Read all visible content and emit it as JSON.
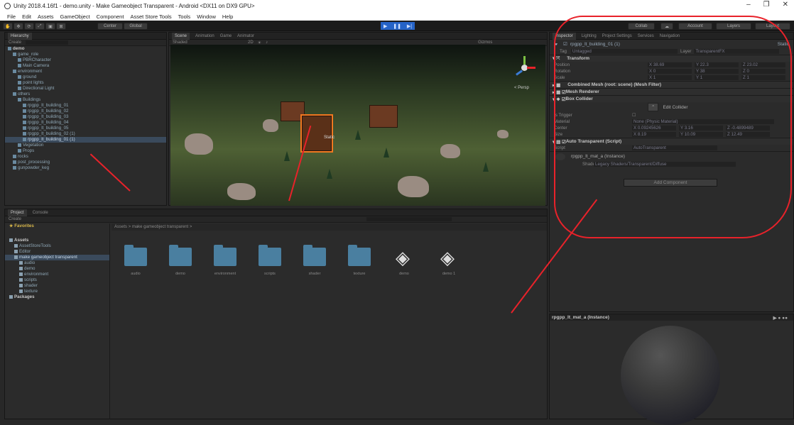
{
  "window": {
    "title": "Unity 2018.4.16f1 - demo.unity - Make Gameobject Transparent - Android <DX11 on DX9 GPU>"
  },
  "menu": [
    "File",
    "Edit",
    "Assets",
    "GameObject",
    "Component",
    "Asset Store Tools",
    "Tools",
    "Window",
    "Help"
  ],
  "toolbar": {
    "center": "Center",
    "global": "Global",
    "collab": "Collab",
    "account": "Account",
    "layers": "Layers",
    "layout": "Layout"
  },
  "hierarchy": {
    "tab": "Hierarchy",
    "create": "Create",
    "items": [
      {
        "label": "demo",
        "indent": 0,
        "hdr": true
      },
      {
        "label": "game_role",
        "indent": 1
      },
      {
        "label": "PBRCharacter",
        "indent": 2
      },
      {
        "label": "Main Camera",
        "indent": 2
      },
      {
        "label": "environment",
        "indent": 1
      },
      {
        "label": "ground",
        "indent": 2
      },
      {
        "label": "point lights",
        "indent": 2
      },
      {
        "label": "Directional Light",
        "indent": 2
      },
      {
        "label": "others",
        "indent": 1
      },
      {
        "label": "Buildings",
        "indent": 2
      },
      {
        "label": "rpgpp_lt_building_01",
        "indent": 3
      },
      {
        "label": "rpgpp_lt_building_02",
        "indent": 3
      },
      {
        "label": "rpgpp_lt_building_03",
        "indent": 3
      },
      {
        "label": "rpgpp_lt_building_04",
        "indent": 3
      },
      {
        "label": "rpgpp_lt_building_05",
        "indent": 3
      },
      {
        "label": "rpgpp_lt_building_02 (1)",
        "indent": 3
      },
      {
        "label": "rpgpp_lt_building_01 (1)",
        "indent": 3,
        "sel": true
      },
      {
        "label": "Vegetation",
        "indent": 2
      },
      {
        "label": "Props",
        "indent": 2
      },
      {
        "label": "rocks",
        "indent": 1
      },
      {
        "label": "post_processing",
        "indent": 1
      },
      {
        "label": "gunpowder_keg",
        "indent": 1
      }
    ]
  },
  "scene": {
    "tabs": [
      "Scene",
      "Animation",
      "Game",
      "Animator"
    ],
    "shaded": "Shaded",
    "mode2d": "2D",
    "gizmos": "Gizmos",
    "persp": "< Persp",
    "static_label": "Static"
  },
  "inspector": {
    "tabs": [
      "Inspector",
      "Lighting",
      "Project Settings",
      "Services",
      "Navigation"
    ],
    "object_name": "rpgpp_lt_building_01 (1)",
    "static": "Static",
    "tag_label": "Tag",
    "tag": "Untagged",
    "layer_label": "Layer",
    "layer": "TransparentFX",
    "transform": {
      "title": "Transform",
      "rows": [
        {
          "label": "Position",
          "x": "X 38.69",
          "y": "Y 22.3",
          "z": "Z 23.02"
        },
        {
          "label": "Rotation",
          "x": "X 0",
          "y": "Y 38",
          "z": "Z 0"
        },
        {
          "label": "Scale",
          "x": "X 1",
          "y": "Y 1",
          "z": "Z 1"
        }
      ]
    },
    "mesh_filter": "Combined Mesh (root: scene) (Mesh Filter)",
    "mesh_renderer": "Mesh Renderer",
    "box_collider": {
      "title": "Box Collider",
      "edit": "Edit Collider",
      "is_trigger": "Is Trigger",
      "material_label": "Material",
      "material": "None (Physic Material)",
      "center_label": "Center",
      "center": [
        "X 0.09245626",
        "Y 3.16",
        "Z -0.4899489"
      ],
      "size_label": "Size",
      "size": [
        "X 8.19",
        "Y 10.09",
        "Z 12.49"
      ]
    },
    "auto_transparent": {
      "title": "Auto Transparent (Script)",
      "script_label": "Script",
      "script": "AutoTransparent"
    },
    "material": {
      "name": "rpgpp_lt_mat_a (Instance)",
      "shader_label": "Shader",
      "shader": "Legacy Shaders/Transparent/Diffuse"
    },
    "add_component": "Add Component"
  },
  "project": {
    "tabs": [
      "Project",
      "Console"
    ],
    "create": "Create",
    "favorites": "Favorites",
    "tree": [
      {
        "label": "Assets",
        "indent": 0,
        "hdr": true
      },
      {
        "label": "AssetStoreTools",
        "indent": 1
      },
      {
        "label": "Editor",
        "indent": 1
      },
      {
        "label": "make gameobject transparent",
        "indent": 1,
        "sel": true
      },
      {
        "label": "audio",
        "indent": 2
      },
      {
        "label": "demo",
        "indent": 2
      },
      {
        "label": "environment",
        "indent": 2
      },
      {
        "label": "scripts",
        "indent": 2
      },
      {
        "label": "shader",
        "indent": 2
      },
      {
        "label": "texture",
        "indent": 2
      },
      {
        "label": "Packages",
        "indent": 0,
        "hdr": true
      }
    ],
    "breadcrumb": "Assets > make gameobject transparent >",
    "assets": [
      {
        "label": "audio",
        "type": "folder"
      },
      {
        "label": "demo",
        "type": "folder"
      },
      {
        "label": "environment",
        "type": "folder"
      },
      {
        "label": "scripts",
        "type": "folder"
      },
      {
        "label": "shader",
        "type": "folder"
      },
      {
        "label": "texture",
        "type": "folder"
      },
      {
        "label": "demo",
        "type": "unity"
      },
      {
        "label": "demo 1",
        "type": "unity"
      }
    ]
  },
  "preview": {
    "title": "rpgpp_lt_mat_a (Instance)"
  },
  "colors": {
    "annotation": "#e8222a",
    "selection": "#3a4a5c",
    "play": "#2563c7"
  }
}
